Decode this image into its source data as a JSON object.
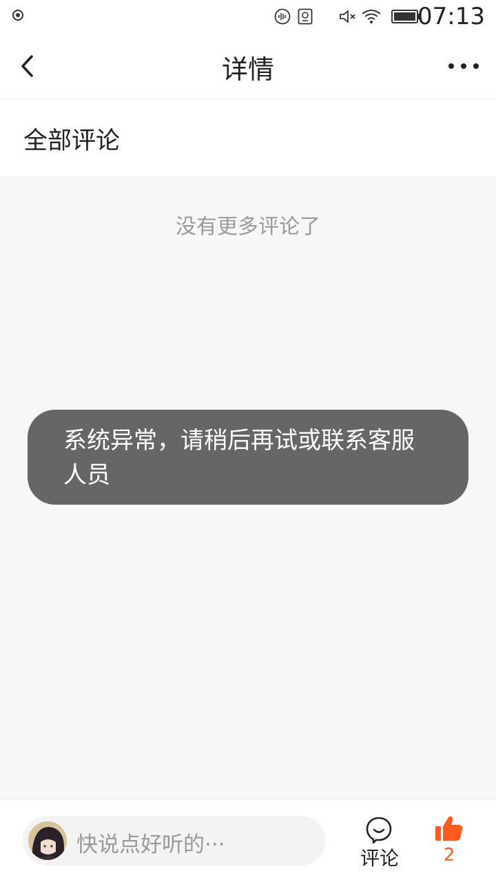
{
  "status_bar": {
    "time": "07:13",
    "icons": [
      "record-icon",
      "sound-wave-icon",
      "screen-record-icon",
      "mute-icon",
      "wifi-icon",
      "battery-icon"
    ]
  },
  "nav": {
    "title": "详情",
    "back_icon": "chevron-left-icon",
    "more_icon": "more-horizontal-icon"
  },
  "section": {
    "title": "全部评论"
  },
  "content": {
    "empty_text": "没有更多评论了"
  },
  "toast": {
    "message": "系统异常，请稍后再试或联系客服人员"
  },
  "bottom_bar": {
    "input_placeholder": "快说点好听的···",
    "comment_label": "评论",
    "like_count": "2",
    "accent_color": "#ff5a1f"
  }
}
